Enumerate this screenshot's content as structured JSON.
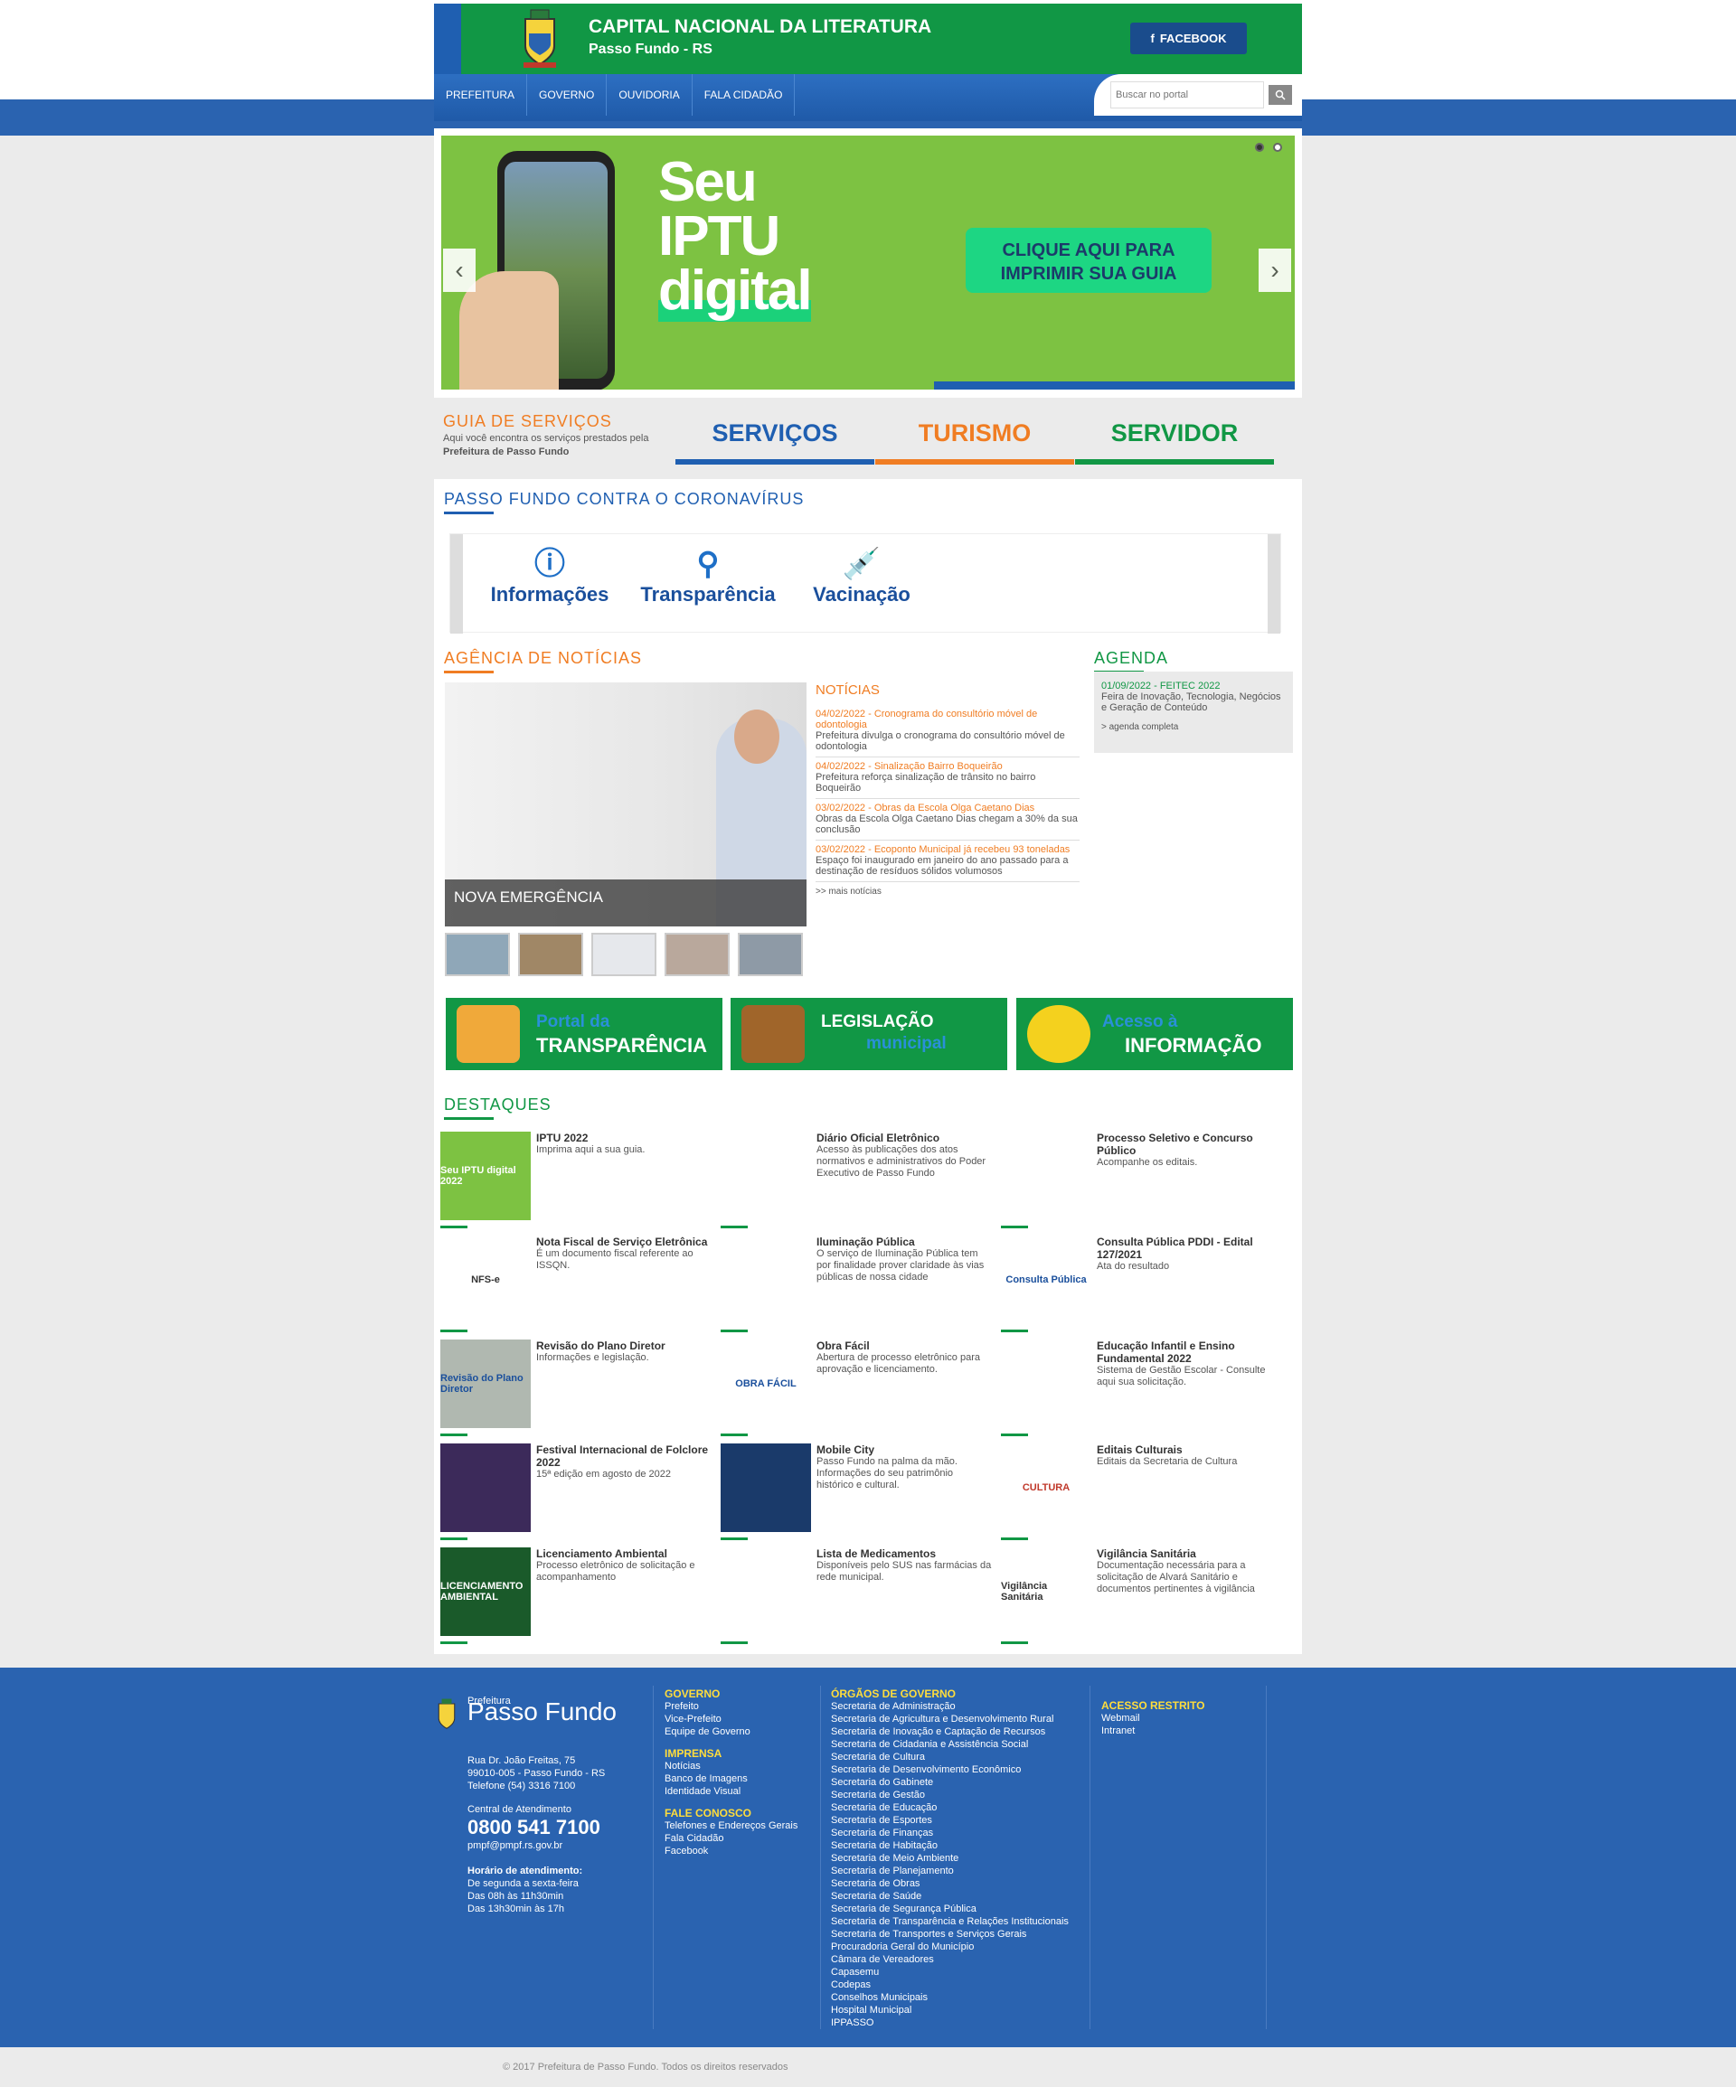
{
  "header": {
    "title": "CAPITAL NACIONAL DA LITERATURA",
    "subtitle": "Passo Fundo - RS",
    "facebook": "FACEBOOK"
  },
  "nav": {
    "items": [
      "PREFEITURA",
      "GOVERNO",
      "OUVIDORIA",
      "FALA CIDADÃO"
    ],
    "search_placeholder": "Buscar no portal"
  },
  "banner": {
    "l1": "Seu",
    "l2": "IPTU",
    "l3": "digital",
    "cta": "CLIQUE AQUI PARA IMPRIMIR SUA GUIA",
    "prev": "‹",
    "next": "›"
  },
  "guia": {
    "title": "GUIA DE SERVIÇOS",
    "desc1": "Aqui você encontra os serviços prestados pela ",
    "desc2": "Prefeitura de Passo Fundo",
    "tabs": [
      "SERVIÇOS",
      "TURISMO",
      "SERVIDOR"
    ],
    "colors": [
      "#1f5fb1",
      "#f07d23",
      "#119745"
    ]
  },
  "covid": {
    "title": "PASSO FUNDO CONTRA O CORONAVÍRUS",
    "items": [
      "Informações",
      "Transparência",
      "Vacinação"
    ]
  },
  "news": {
    "title": "AGÊNCIA DE NOTÍCIAS",
    "caption": "NOVA EMERGÊNCIA",
    "list_title": "NOTÍCIAS",
    "items": [
      {
        "date": "04/02/2022 - Cronograma do consultório móvel de odontologia",
        "text": "Prefeitura divulga o cronograma do consultório móvel de odontologia"
      },
      {
        "date": "04/02/2022 - Sinalização Bairro Boqueirão",
        "text": "Prefeitura reforça sinalização de trânsito no bairro Boqueirão"
      },
      {
        "date": "03/02/2022 - Obras da Escola Olga Caetano Dias",
        "text": "Obras da Escola Olga Caetano Dias chegam a 30% da sua conclusão"
      },
      {
        "date": "03/02/2022 - Ecoponto Municipal já recebeu 93 toneladas",
        "text": "Espaço foi inaugurado em janeiro do ano passado para a destinação de resíduos sólidos volumosos"
      }
    ],
    "more": ">> mais notícias"
  },
  "agenda": {
    "title": "AGENDA",
    "date": "01/09/2022 - FEITEC 2022",
    "text": "Feira de Inovação, Tecnologia, Negócios e Geração de Conteúdo",
    "more": "> agenda completa"
  },
  "blocks": [
    {
      "l1": "Portal da",
      "l2": "TRANSPARÊNCIA"
    },
    {
      "l1": "LEGISLAÇÃO",
      "l2": "municipal"
    },
    {
      "l1": "Acesso à",
      "l2": "INFORMAÇÃO"
    }
  ],
  "destaques": {
    "title": "DESTAQUES",
    "items": [
      {
        "t": "IPTU 2022",
        "d": "Imprima aqui a sua guia.",
        "img": "Seu IPTU digital 2022"
      },
      {
        "t": "Diário Oficial Eletrônico",
        "d": "Acesso às publicações dos atos normativos e administrativos do Poder Executivo de Passo Fundo",
        "img": ""
      },
      {
        "t": "Processo Seletivo e Concurso Público",
        "d": "Acompanhe os editais.",
        "img": ""
      },
      {
        "t": "Nota Fiscal de Serviço Eletrônica",
        "d": "É um documento fiscal referente ao ISSQN.",
        "img": "NFS-e"
      },
      {
        "t": "Iluminação Pública",
        "d": "O serviço de Iluminação Pública tem por finalidade prover claridade às vias públicas de nossa cidade",
        "img": ""
      },
      {
        "t": "Consulta Pública PDDI - Edital 127/2021",
        "d": "Ata do resultado",
        "img": "Consulta Pública"
      },
      {
        "t": "Revisão do Plano Diretor",
        "d": "Informações e legislação.",
        "img": "Revisão do Plano Diretor"
      },
      {
        "t": "Obra Fácil",
        "d": "Abertura de processo eletrônico para aprovação e licenciamento.",
        "img": "OBRA FÁCIL"
      },
      {
        "t": "Educação Infantil e Ensino Fundamental 2022",
        "d": "Sistema de Gestão Escolar - Consulte aqui sua solicitação.",
        "img": ""
      },
      {
        "t": "Festival Internacional de Folclore 2022",
        "d": "15ª edição em agosto de 2022",
        "img": ""
      },
      {
        "t": "Mobile City",
        "d": "Passo Fundo na palma da mão. Informações do seu patrimônio histórico e cultural.",
        "img": ""
      },
      {
        "t": "Editais Culturais",
        "d": "Editais da Secretaria de Cultura",
        "img": "CULTURA"
      },
      {
        "t": "Licenciamento Ambiental",
        "d": "Processo eletrônico de solicitação e acompanhamento",
        "img": "LICENCIAMENTO AMBIENTAL"
      },
      {
        "t": "Lista de Medicamentos",
        "d": "Disponíveis pelo SUS nas farmácias da rede municipal.",
        "img": ""
      },
      {
        "t": "Vigilância Sanitária",
        "d": "Documentação necessária para a solicitação de Alvará Sanitário e documentos pertinentes à vigilância",
        "img": "Vigilância Sanitária"
      }
    ]
  },
  "footer": {
    "pref": "Prefeitura",
    "city": "Passo Fundo",
    "addr1": "Rua Dr. João Freitas, 75",
    "addr2": "99010-005 - Passo Fundo - RS",
    "tel": "Telefone (54) 3316 7100",
    "central": "Central de Atendimento",
    "phone": "0800 541 7100",
    "email": "pmpf@pmpf.rs.gov.br",
    "hours_t": "Horário de atendimento:",
    "hours1": "De segunda a sexta-feira",
    "hours2": "Das 08h às 11h30min",
    "hours3": "Das 13h30min às 17h",
    "gov_t": "GOVERNO",
    "gov": [
      "Prefeito",
      "Vice-Prefeito",
      "Equipe de Governo"
    ],
    "imp_t": "IMPRENSA",
    "imp": [
      "Notícias",
      "Banco de Imagens",
      "Identidade Visual"
    ],
    "fale_t": "FALE CONOSCO",
    "fale": [
      "Telefones e Endereços Gerais",
      "Fala Cidadão",
      "Facebook"
    ],
    "org_t": "ÓRGÃOS DE GOVERNO",
    "org": [
      "Secretaria de Administração",
      "Secretaria de Agricultura e Desenvolvimento Rural",
      "Secretaria de Inovação e Captação de Recursos",
      "Secretaria de Cidadania e Assistência Social",
      "Secretaria de Cultura",
      "Secretaria de Desenvolvimento Econômico",
      "Secretaria do Gabinete",
      "Secretaria de Gestão",
      "Secretaria de Educação",
      "Secretaria de Esportes",
      "Secretaria de Finanças",
      "Secretaria de Habitação",
      "Secretaria de Meio Ambiente",
      "Secretaria de Planejamento",
      "Secretaria de Obras",
      "Secretaria de Saúde",
      "Secretaria de Segurança Pública",
      "Secretaria de Transparência e Relações Institucionais",
      "Secretaria de Transportes e Serviços Gerais",
      "Procuradoria Geral do Município",
      "Câmara de Vereadores",
      "Capasemu",
      "Codepas",
      "Conselhos Municipais",
      "Hospital Municipal",
      "IPPASSO"
    ],
    "acc_t": "ACESSO RESTRITO",
    "acc": [
      "Webmail",
      "Intranet"
    ],
    "copy": "© 2017 Prefeitura de Passo Fundo. Todos os direitos reservados"
  }
}
